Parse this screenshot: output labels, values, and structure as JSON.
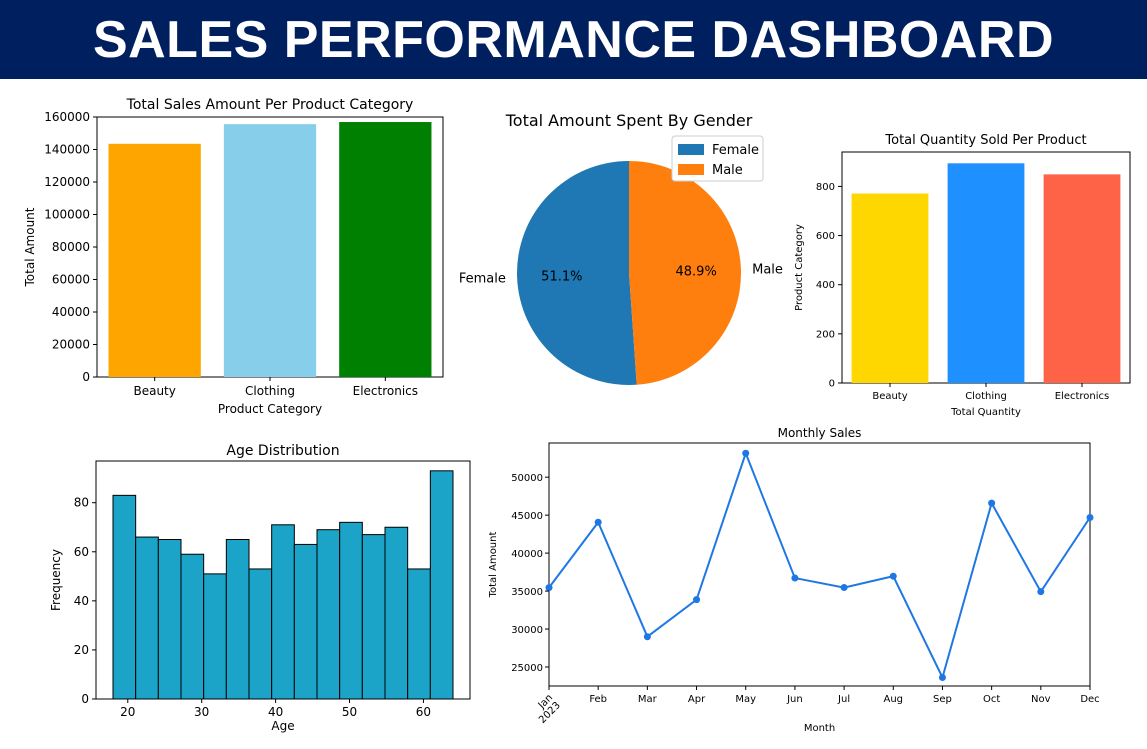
{
  "header": {
    "title": "SALES PERFORMANCE DASHBOARD",
    "bg": "#001f5e"
  },
  "chart_data": [
    {
      "type": "bar",
      "title": "Total Sales Amount Per Product Category",
      "xlabel": "Product Category",
      "ylabel": "Total Amount",
      "categories": [
        "Beauty",
        "Clothing",
        "Electronics"
      ],
      "values": [
        143515,
        155580,
        156905
      ],
      "colors": [
        "#ffa500",
        "#87ceeb",
        "#008000"
      ],
      "ylim": [
        0,
        160000
      ],
      "yticks": [
        "0",
        "20000",
        "40000",
        "60000",
        "80000",
        "100000",
        "120000",
        "140000",
        "160000"
      ],
      "grid": false
    },
    {
      "type": "pie",
      "title": "Total Amount Spent By Gender",
      "labels": [
        "Female",
        "Male"
      ],
      "values": [
        51.1,
        48.9
      ],
      "pct_labels": [
        "51.1%",
        "48.9%"
      ],
      "colors": [
        "#1f77b4",
        "#ff7f0e"
      ],
      "legend": "top-right"
    },
    {
      "type": "bar",
      "title": "Total Quantity Sold Per Product",
      "xlabel": "Total Quantity",
      "ylabel": "Product Category",
      "categories": [
        "Beauty",
        "Clothing",
        "Electronics"
      ],
      "values": [
        771,
        894,
        849
      ],
      "colors": [
        "#ffd700",
        "#1e90ff",
        "#ff6347"
      ],
      "ylim": [
        0,
        940
      ],
      "yticks": [
        "0",
        "200",
        "400",
        "600",
        "800"
      ],
      "grid": false
    },
    {
      "type": "bar",
      "subtype": "histogram",
      "title": "Age Distribution",
      "xlabel": "Age",
      "ylabel": "Frequency",
      "bin_range": [
        18,
        64
      ],
      "values": [
        83,
        66,
        65,
        59,
        51,
        65,
        53,
        71,
        63,
        69,
        72,
        67,
        70,
        53,
        93
      ],
      "color": "#1ba4c8",
      "xticks": [
        "20",
        "30",
        "40",
        "50",
        "60"
      ],
      "xtick_values": [
        20,
        30,
        40,
        50,
        60
      ],
      "yticks": [
        "0",
        "20",
        "40",
        "60",
        "80"
      ],
      "ylim": [
        0,
        97
      ],
      "xlim": [
        15.7,
        66.3
      ]
    },
    {
      "type": "line",
      "title": "Monthly Sales",
      "xlabel": "Month",
      "ylabel": "Total Amount",
      "categories": [
        "Jan\n2023",
        "Feb",
        "Mar",
        "Apr",
        "May",
        "Jun",
        "Jul",
        "Aug",
        "Sep",
        "Oct",
        "Nov",
        "Dec"
      ],
      "values": [
        35450,
        44060,
        28990,
        33870,
        53150,
        36715,
        35465,
        36960,
        23620,
        46580,
        34920,
        44690
      ],
      "color": "#1f77e4",
      "ylim": [
        22500,
        54500
      ],
      "yticks": [
        "25000",
        "30000",
        "35000",
        "40000",
        "45000",
        "50000"
      ],
      "ytick_values": [
        25000,
        30000,
        35000,
        40000,
        45000,
        50000
      ]
    }
  ]
}
